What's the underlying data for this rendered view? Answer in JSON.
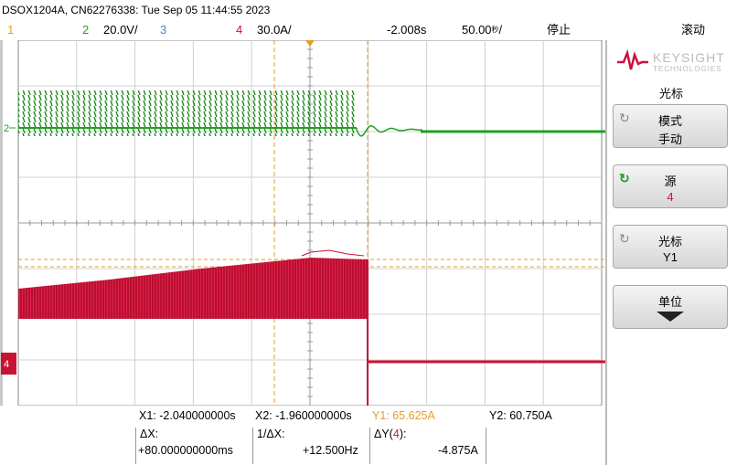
{
  "title": {
    "device": "DSOX1204A, CN62276338: Tue Sep 05 11:44:55 2023"
  },
  "channel_bar": {
    "ch1": "1",
    "ch2": "2",
    "ch2_scale": "20.0V/",
    "ch3": "3",
    "ch4": "4",
    "ch4_scale": "30.0A/",
    "time_offset": "-2.008s",
    "time_scale": "50.00",
    "time_unit": "秒",
    "run_state": "停止",
    "mode": "滚动"
  },
  "colors": {
    "ch1": "#e6a020",
    "ch2": "#21a021",
    "ch3": "#3a8ad8",
    "ch4": "#d0103a",
    "cursor": "#e79b2a",
    "grid": "#d0d0d0"
  },
  "markers": {
    "ch2": "2",
    "ch4": "4"
  },
  "panel": {
    "brand": "KEYSIGHT",
    "brand_sub": "TECHNOLOGIES",
    "title": "光标",
    "buttons": [
      {
        "label": "模式",
        "value": "手动",
        "icon": "rotate-icon"
      },
      {
        "label": "源",
        "value": "4",
        "icon": "rotate-icon"
      },
      {
        "label": "光标",
        "value": "Y1",
        "icon": "rotate-icon"
      },
      {
        "label": "单位",
        "value": "",
        "icon": "arrow-down-icon"
      }
    ]
  },
  "measurements": {
    "x1": "X1: -2.040000000s",
    "x2": "X2: -1.960000000s",
    "y1": "Y1:  65.625A",
    "y2": "Y2:  60.750A",
    "dx_label": "ΔX:",
    "dx_value": "+80.000000000ms",
    "inv_dx_label": "1/ΔX:",
    "inv_dx_value": "+12.500Hz",
    "dy_label_pre": "ΔY(",
    "dy_label_ch": "4",
    "dy_label_post": "):",
    "dy_value": "-4.875A"
  }
}
